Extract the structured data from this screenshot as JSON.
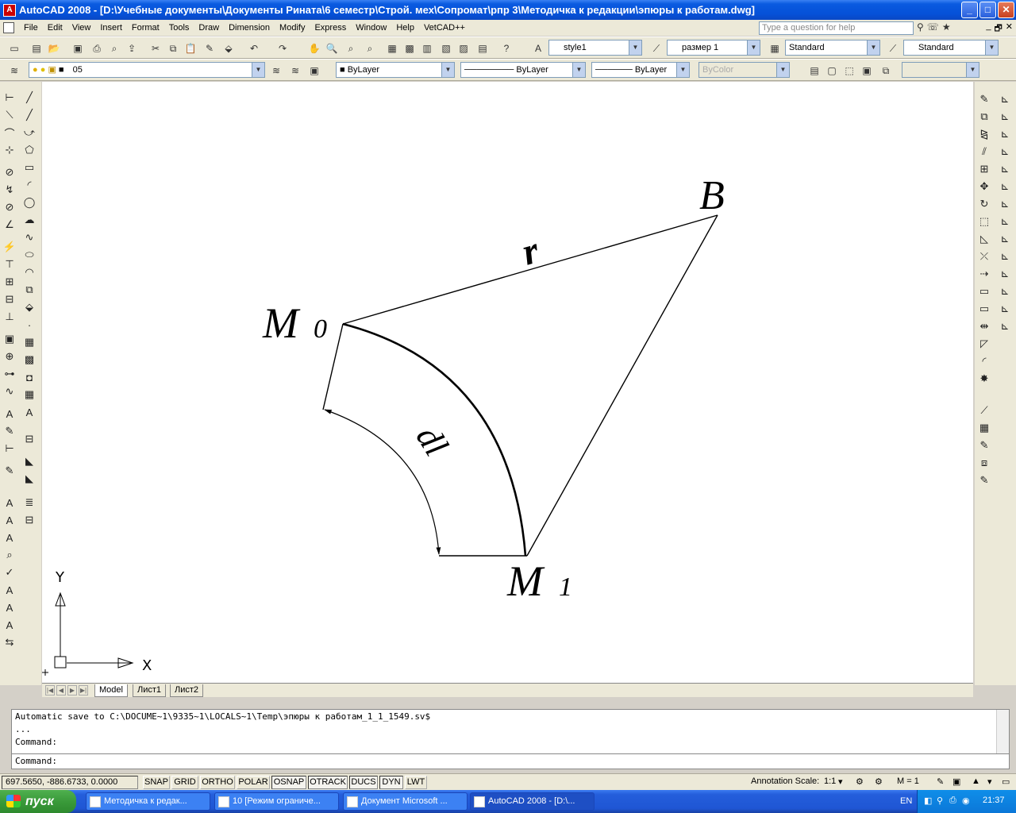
{
  "window": {
    "title": "AutoCAD 2008 - [D:\\Учебные документы\\Документы Рината\\6 семестр\\Строй. мех\\Сопромат\\рпр 3\\Методичка к редакции\\эпюры к работам.dwg]",
    "app_icon": "A",
    "minimize": "_",
    "maximize": "□",
    "close": "✕"
  },
  "menu": {
    "items": [
      "File",
      "Edit",
      "View",
      "Insert",
      "Format",
      "Tools",
      "Draw",
      "Dimension",
      "Modify",
      "Express",
      "Window",
      "Help",
      "VetCAD++"
    ],
    "help_placeholder": "Type a question for help",
    "doc_min": "_",
    "doc_restore": "🗗",
    "doc_close": "✕"
  },
  "toolbar1": {
    "text_style": "style1",
    "dim_style": "размер 1",
    "table_style": "Standard",
    "multileader_style": "Standard"
  },
  "toolbar2": {
    "layer": "05",
    "color": "ByLayer",
    "linetype": "ByLayer",
    "lineweight": "ByLayer",
    "plotstyle": "ByColor"
  },
  "drawing": {
    "label_B": "B",
    "label_r": "r",
    "label_M0": "M",
    "label_M0_sub": "0",
    "label_M1": "M",
    "label_M1_sub": "1",
    "label_dl": "dl",
    "ucs_y": "Y",
    "ucs_x": "X"
  },
  "tabs": {
    "model": "Model",
    "layout1": "Лист1",
    "layout2": "Лист2"
  },
  "command": {
    "line1": "Automatic save to C:\\DOCUME~1\\9335~1\\LOCALS~1\\Temp\\эпюры к работам_1_1_1549.sv$",
    "line2": "...",
    "line3": "Command:",
    "prompt": "Command:"
  },
  "status": {
    "coords": "697.5650, -886.6733, 0.0000",
    "buttons": [
      "SNAP",
      "GRID",
      "ORTHO",
      "POLAR",
      "OSNAP",
      "OTRACK",
      "DUCS",
      "DYN",
      "LWT"
    ],
    "annotation_scale_label": "Annotation Scale:",
    "annotation_scale": "1:1",
    "m_value": "M = 1"
  },
  "taskbar": {
    "start": "пуск",
    "tasks": [
      "Методичка к редак...",
      "10 [Режим ограниче...",
      "Документ Microsoft ...",
      "AutoCAD 2008 - [D:\\..."
    ],
    "lang": "EN",
    "clock": "21:37"
  }
}
